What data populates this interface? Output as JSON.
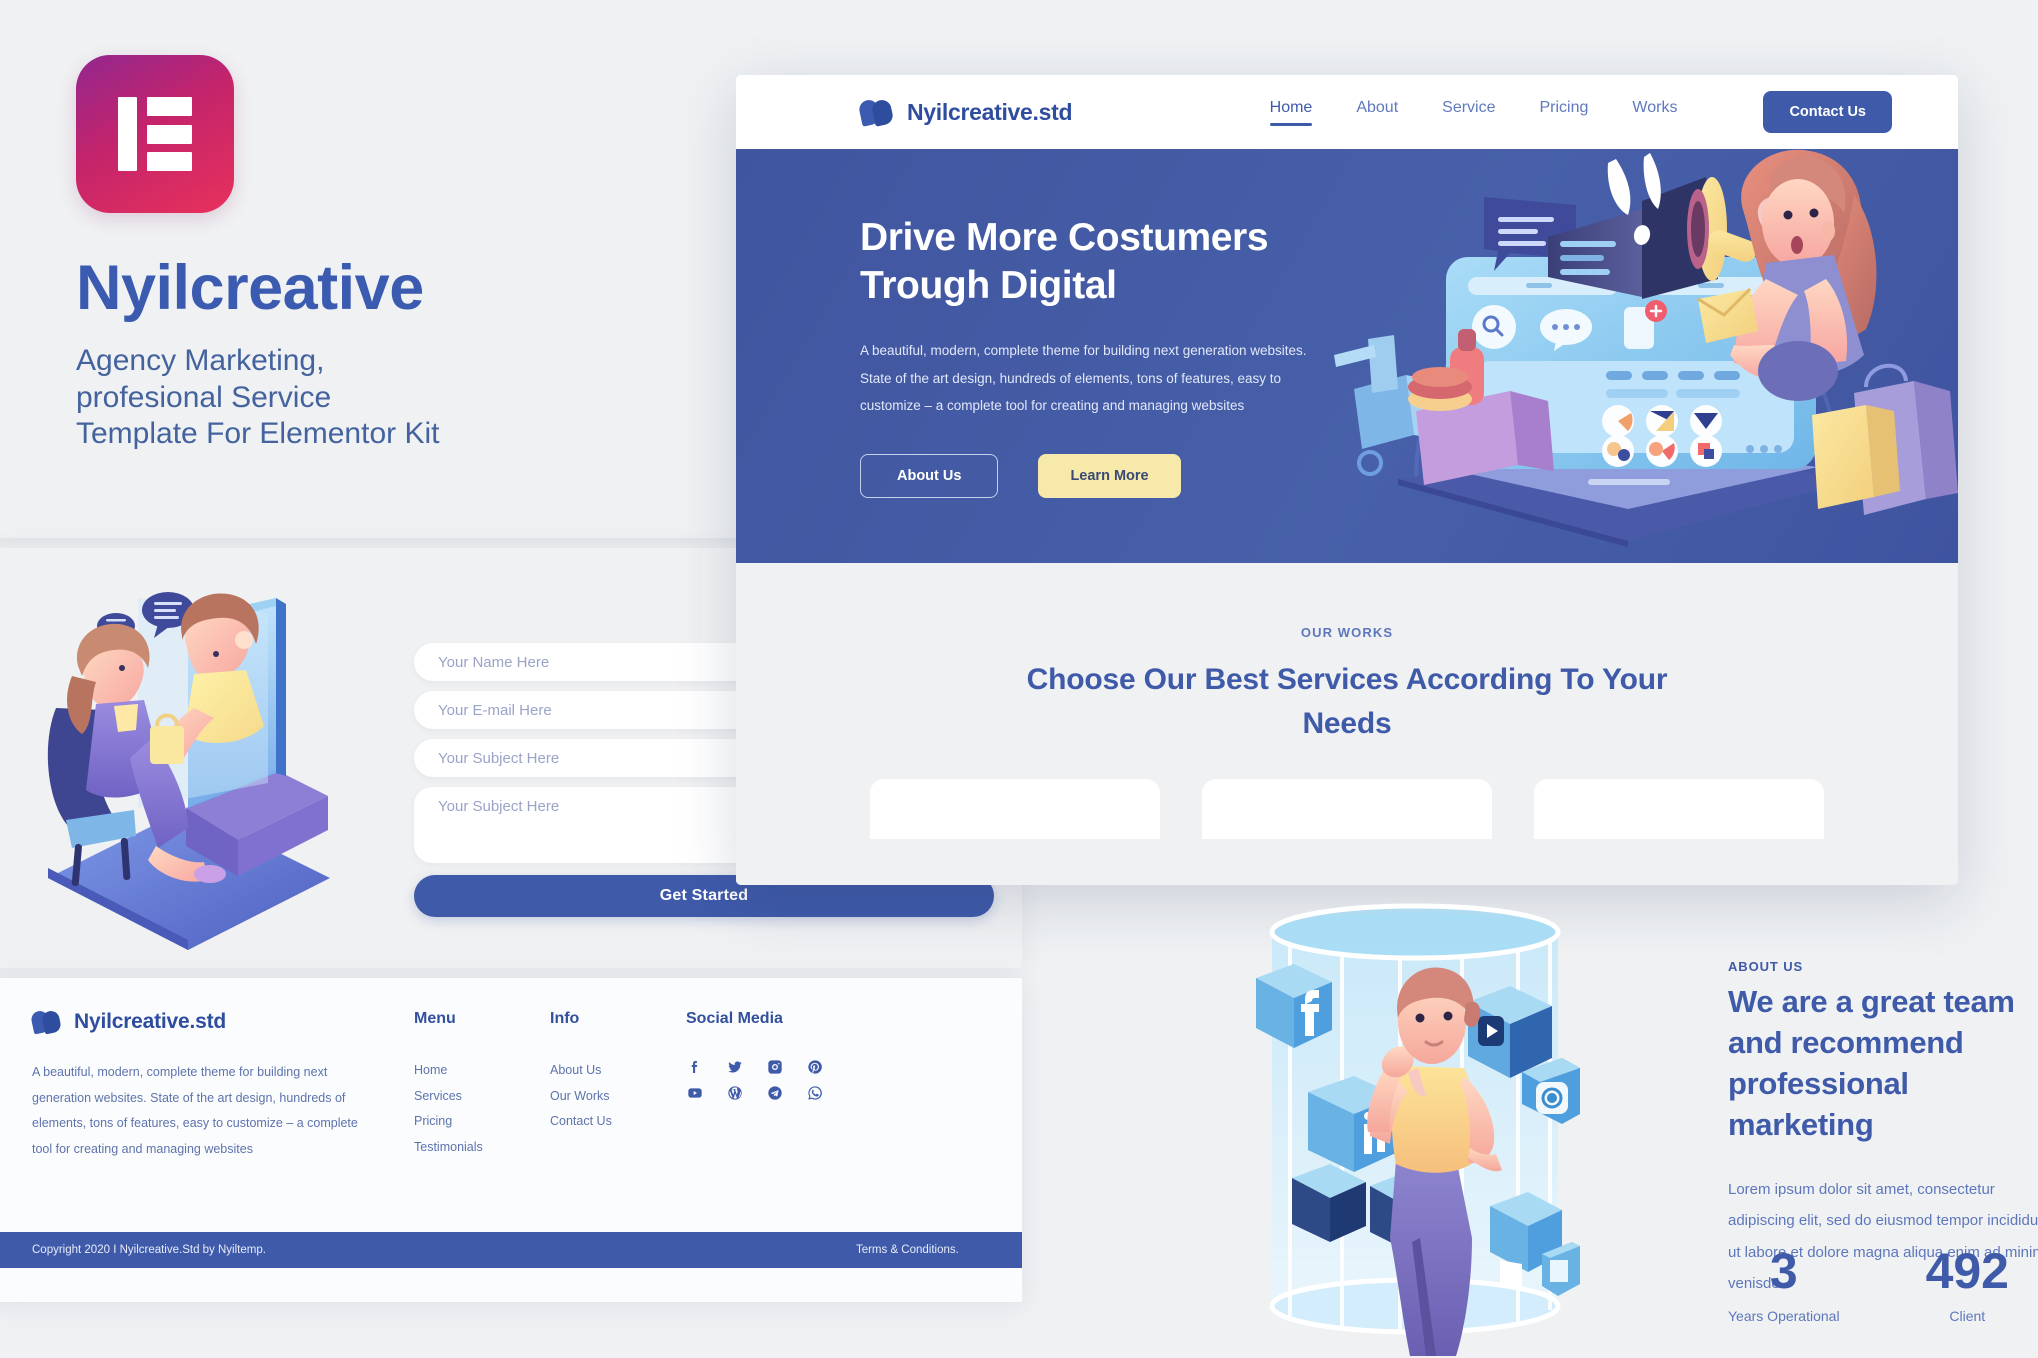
{
  "intro": {
    "logo_icon": "elementor-logo-icon",
    "brand": "Nyilcreative",
    "tagline": "Agency Marketing,\nprofesional Service\nTemplate For Elementor Kit"
  },
  "navbar": {
    "logo_icon": "nyilcreative-mark-icon",
    "logo_text": "Nyilcreative.std",
    "links": [
      {
        "label": "Home",
        "active": true
      },
      {
        "label": "About",
        "active": false
      },
      {
        "label": "Service",
        "active": false
      },
      {
        "label": "Pricing",
        "active": false
      },
      {
        "label": "Works",
        "active": false
      }
    ],
    "cta_label": "Contact Us"
  },
  "hero": {
    "heading_line1": "Drive More Costumers",
    "heading_line2": "Trough Digital",
    "paragraph": "A beautiful, modern, complete theme for building next generation websites. State of the art design, hundreds of elements, tons of features, easy to customize – a complete tool for creating and managing websites",
    "btn_secondary": "About Us",
    "btn_primary": "Learn More",
    "illustration": "woman-with-megaphone-ecommerce-illustration",
    "bg_color": "#44589f"
  },
  "works": {
    "eyebrow": "OUR WORKS",
    "title": "Choose Our Best Services According To Your Needs"
  },
  "contact_form": {
    "illustration": "video-call-shopping-illustration",
    "fields": [
      {
        "name": "name",
        "placeholder": "Your Name Here"
      },
      {
        "name": "email",
        "placeholder": "Your E-mail Here"
      },
      {
        "name": "subject",
        "placeholder": "Your Subject Here"
      },
      {
        "name": "message",
        "placeholder": "Your Subject Here"
      }
    ],
    "submit_label": "Get Started"
  },
  "footer": {
    "logo_text": "Nyilcreative.std",
    "about_text": "A beautiful, modern, complete theme for building next generation websites. State of the art design, hundreds of elements, tons of features, easy to customize – a complete tool for creating and managing websites",
    "menu": {
      "heading": "Menu",
      "items": [
        "Home",
        "Services",
        "Pricing",
        "Testimonials"
      ]
    },
    "info": {
      "heading": "Info",
      "items": [
        "About Us",
        "Our Works",
        "Contact Us"
      ]
    },
    "social": {
      "heading": "Social Media",
      "icons": [
        "facebook-icon",
        "twitter-icon",
        "instagram-icon",
        "pinterest-icon",
        "youtube-icon",
        "wordpress-icon",
        "telegram-icon",
        "whatsapp-icon"
      ]
    },
    "copyright": "Copyright 2020 I Nyilcreative.Std by Nyiltemp.",
    "terms": "Terms & Conditions."
  },
  "about": {
    "illustration": "man-with-social-media-cubes-illustration",
    "eyebrow": "ABOUT US",
    "heading": "We are a great team and recommend professional marketing",
    "paragraph": "Lorem ipsum dolor sit amet, consectetur adipiscing elit, sed do eiusmod tempor incididunt ut labore et dolore magna aliqua enim ad minim venisde.",
    "stats": [
      {
        "value": "3",
        "label": "Years Operational"
      },
      {
        "value": "492",
        "label": "Client"
      }
    ]
  },
  "colors": {
    "brand_blue": "#3f5aa9",
    "text_blue": "#5e77bc",
    "hero_bg": "#44589f",
    "accent_yellow": "#f6e9a9",
    "page_bg": "#eff1f3"
  }
}
